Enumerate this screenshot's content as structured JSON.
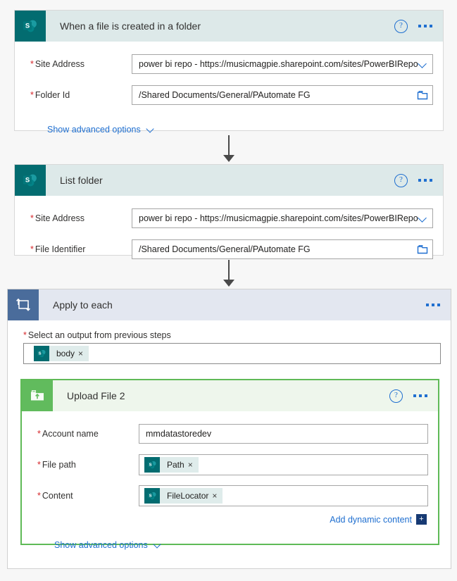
{
  "flow": {
    "cards": [
      {
        "id": "trigger",
        "title": "When a file is created in a folder",
        "icon": "sharepoint-icon",
        "accent": "#036c70",
        "fields": [
          {
            "label": "Site Address",
            "required": true,
            "value": "power bi repo - https://musicmagpie.sharepoint.com/sites/PowerBIRepo",
            "control": "dropdown",
            "control_icon": "chevron-down-icon"
          },
          {
            "label": "Folder Id",
            "required": true,
            "value": "/Shared Documents/General/PAutomate FG",
            "control": "picker",
            "control_icon": "folder-picker-icon"
          }
        ],
        "advanced_label": "Show advanced options"
      },
      {
        "id": "list-folder",
        "title": "List folder",
        "icon": "sharepoint-icon",
        "accent": "#036c70",
        "fields": [
          {
            "label": "Site Address",
            "required": true,
            "value": "power bi repo - https://musicmagpie.sharepoint.com/sites/PowerBIRepo",
            "control": "dropdown",
            "control_icon": "chevron-down-icon"
          },
          {
            "label": "File Identifier",
            "required": true,
            "value": "/Shared Documents/General/PAutomate FG",
            "control": "picker",
            "control_icon": "folder-picker-icon"
          }
        ]
      }
    ],
    "loop": {
      "title": "Apply to each",
      "icon": "loop-icon",
      "accent": "#4a6c9b",
      "output_label": "Select an output from previous steps",
      "output_required": true,
      "output_token": {
        "label": "body",
        "icon": "sharepoint-icon",
        "remove": "×"
      }
    },
    "upload": {
      "title": "Upload File 2",
      "icon": "upload-folder-icon",
      "accent": "#61bb5d",
      "fields": [
        {
          "label": "Account name",
          "required": true,
          "type": "text",
          "value": "mmdatastoredev"
        },
        {
          "label": "File path",
          "required": true,
          "type": "token",
          "token": {
            "label": "Path",
            "icon": "sharepoint-icon",
            "remove": "×"
          }
        },
        {
          "label": "Content",
          "required": true,
          "type": "token",
          "token": {
            "label": "FileLocator",
            "icon": "sharepoint-icon",
            "remove": "×"
          }
        }
      ],
      "add_dynamic_content_label": "Add dynamic content",
      "add_dynamic_content_plus": "+",
      "advanced_label": "Show advanced options"
    },
    "required_marker": "*",
    "help_glyph": "?"
  }
}
